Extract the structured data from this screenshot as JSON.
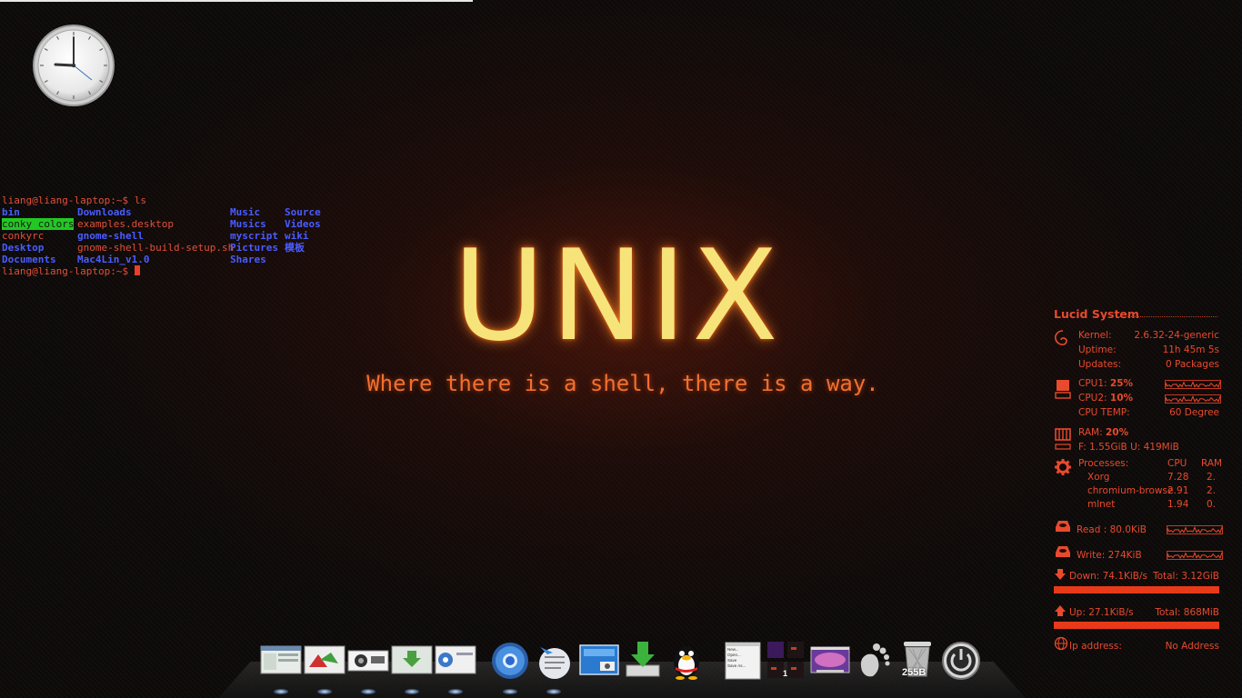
{
  "terminal": {
    "prompt_line": "liang@liang-laptop:~$ ls",
    "final_prompt": "liang@liang-laptop:~$ ",
    "ls_entries": [
      {
        "name": "bin",
        "kind": "dir",
        "col": 0,
        "row": 0
      },
      {
        "name": "conky colors",
        "kind": "highlight",
        "col": 0,
        "row": 1
      },
      {
        "name": "conkyrc",
        "kind": "file",
        "col": 0,
        "row": 2
      },
      {
        "name": "Desktop",
        "kind": "dir",
        "col": 0,
        "row": 3
      },
      {
        "name": "Documents",
        "kind": "dir",
        "col": 0,
        "row": 4
      },
      {
        "name": "Downloads",
        "kind": "dir",
        "col": 1,
        "row": 0
      },
      {
        "name": "examples.desktop",
        "kind": "file",
        "col": 1,
        "row": 1
      },
      {
        "name": "gnome-shell",
        "kind": "dir",
        "col": 1,
        "row": 2
      },
      {
        "name": "gnome-shell-build-setup.sh",
        "kind": "file",
        "col": 1,
        "row": 3
      },
      {
        "name": "Mac4Lin_v1.0",
        "kind": "dir",
        "col": 1,
        "row": 4
      },
      {
        "name": "Music",
        "kind": "dir",
        "col": 2,
        "row": 0
      },
      {
        "name": "Musics",
        "kind": "dir",
        "col": 2,
        "row": 1
      },
      {
        "name": "myscript",
        "kind": "dir",
        "col": 2,
        "row": 2
      },
      {
        "name": "Pictures",
        "kind": "dir",
        "col": 2,
        "row": 3
      },
      {
        "name": "Shares",
        "kind": "dir",
        "col": 2,
        "row": 4
      },
      {
        "name": "Source",
        "kind": "dir",
        "col": 3,
        "row": 0
      },
      {
        "name": "Videos",
        "kind": "dir",
        "col": 3,
        "row": 1
      },
      {
        "name": "wiki",
        "kind": "dir",
        "col": 3,
        "row": 2
      },
      {
        "name": "模板",
        "kind": "dir",
        "col": 3,
        "row": 3
      }
    ]
  },
  "wallpaper": {
    "title": "UNIX",
    "tagline": "Where there is a shell, there is a way."
  },
  "conky": {
    "header": "Lucid System",
    "kernel_label": "Kernel:",
    "kernel_value": "2.6.32-24-generic",
    "uptime_label": "Uptime:",
    "uptime_value": "11h 45m 5s",
    "updates_label": "Updates:",
    "updates_value": "0 Packages",
    "cpu1_label": "CPU1: ",
    "cpu1_value": "25%",
    "cpu2_label": "CPU2: ",
    "cpu2_value": "10%",
    "cpu_temp_label": "CPU TEMP:",
    "cpu_temp_value": "60 Degree",
    "ram_label": "RAM: ",
    "ram_value": "20%",
    "ram_detail": "F: 1.55GiB U: 419MiB",
    "processes_label": "Processes:",
    "proc_cpu_header": "CPU",
    "proc_ram_header": "RAM",
    "processes": [
      {
        "name": "Xorg",
        "cpu": "7.28",
        "ram": "2."
      },
      {
        "name": "chromium-browse",
        "cpu": "2.91",
        "ram": "2."
      },
      {
        "name": "mlnet",
        "cpu": "1.94",
        "ram": "0."
      }
    ],
    "read_label": "Read : 80.0KiB",
    "write_label": "Write: 274KiB",
    "down_label": "Down: 74.1KiB/s",
    "down_total": "Total: 3.12GiB",
    "up_label": "Up: 27.1KiB/s",
    "up_total": "Total: 868MiB",
    "ip_label": "Ip address:",
    "ip_value": "No Address",
    "accent_color": "#e84a2e"
  },
  "dock": {
    "items": [
      {
        "name": "window-thumbnail-1-icon",
        "running": true
      },
      {
        "name": "window-thumbnail-2-icon",
        "running": true
      },
      {
        "name": "window-thumbnail-3-icon",
        "running": true
      },
      {
        "name": "window-thumbnail-4-icon",
        "running": true
      },
      {
        "name": "window-thumbnail-5-icon",
        "running": true
      },
      {
        "name": "chromium-icon",
        "running": true
      },
      {
        "name": "mail-icon",
        "running": true
      },
      {
        "name": "screenshot-icon",
        "running": false
      },
      {
        "name": "download-icon",
        "running": false
      },
      {
        "name": "qq-penguin-icon",
        "running": false
      },
      {
        "name": "file-menu-icon",
        "running": false
      },
      {
        "name": "workspace-switcher-icon",
        "running": false
      },
      {
        "name": "desktop-preview-icon",
        "running": false
      },
      {
        "name": "gnome-foot-icon",
        "running": false
      },
      {
        "name": "trash-icon",
        "running": false
      },
      {
        "name": "power-icon",
        "running": false
      }
    ],
    "workspace_number": "1",
    "trash_size": "255B",
    "file_menu_items": [
      "New...",
      "Open...",
      "Save",
      "Save As..."
    ]
  }
}
